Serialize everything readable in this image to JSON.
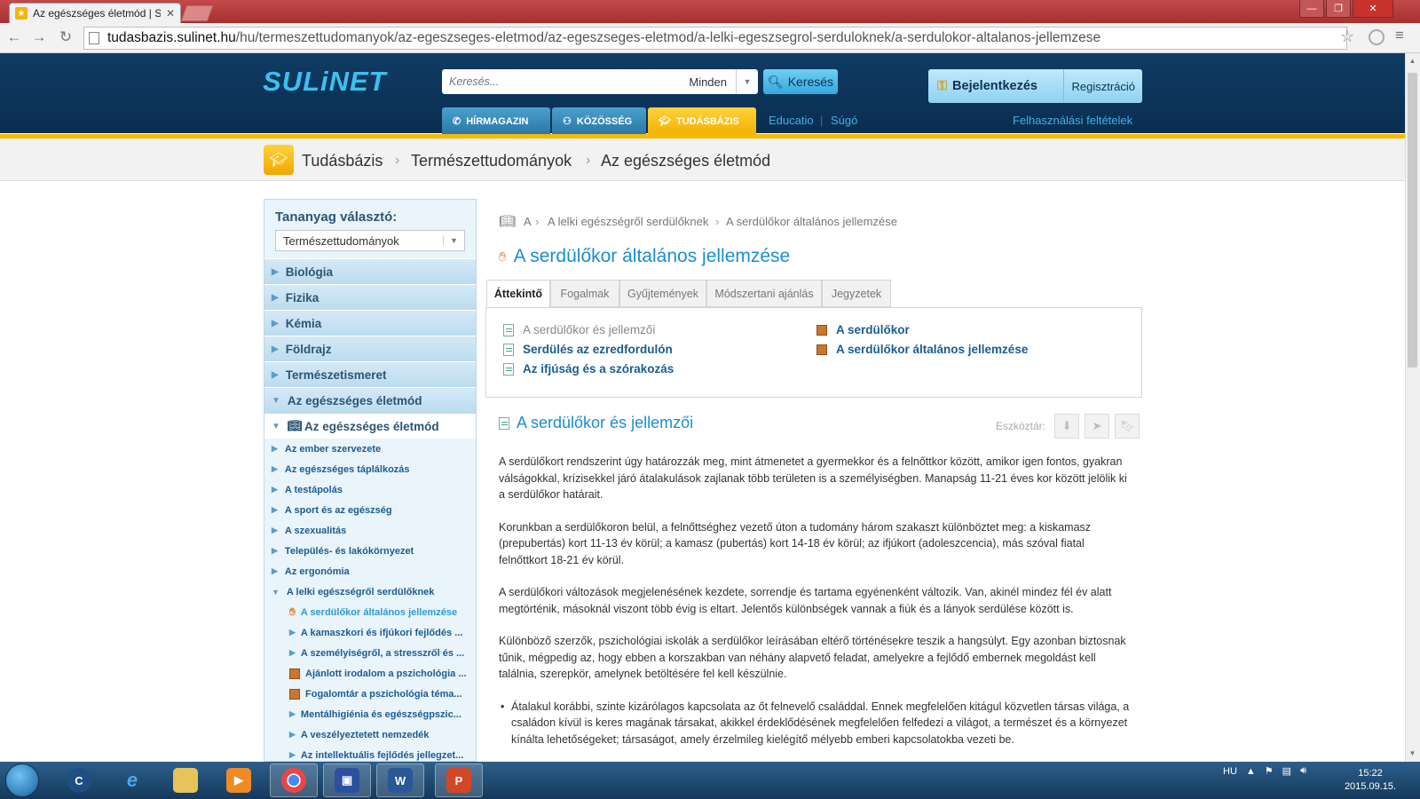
{
  "browser": {
    "tab_title": "Az egészséges életmód | S",
    "url_host": "tudasbazis.sulinet.hu",
    "url_path": "/hu/termeszettudomanyok/az-egeszseges-eletmod/az-egeszseges-eletmod/a-lelki-egeszsegrol-serduloknek/a-serdulokor-altalanos-jellemzese"
  },
  "header": {
    "logo": "SULiNET",
    "search_placeholder": "Keresés...",
    "search_scope": "Minden",
    "search_button": "Keresés",
    "login": "Bejelentkezés",
    "register": "Regisztráció",
    "tabs": [
      "HÍRMAGAZIN",
      "KÖZÖSSÉG",
      "TUDÁSBÁZIS"
    ],
    "links": [
      "Educatio",
      "Súgó"
    ],
    "terms": "Felhasználási feltételek"
  },
  "breadcrumb": [
    "Tudásbázis",
    "Természettudományok",
    "Az egészséges életmód"
  ],
  "sidebar": {
    "heading": "Tananyag választó:",
    "select_value": "Természettudományok",
    "categories": [
      "Biológia",
      "Fizika",
      "Kémia",
      "Földrajz",
      "Természetismeret",
      "Az egészséges életmód"
    ],
    "active": "Az egészséges életmód",
    "subs": [
      "Az ember szervezete",
      "Az egészséges táplálkozás",
      "A testápolás",
      "A sport és az egészség",
      "A szexualitás",
      "Település- és lakókörnyezet",
      "Az ergonómia",
      "A lelki egészségről serdülőknek"
    ],
    "subs2": [
      "A serdülőkor általános jellemzése",
      "A kamaszkori és ifjúkori fejlődés ...",
      "A személyiségről, a stresszről és ...",
      "Ajánlott irodalom a pszichológia ...",
      "Fogalomtár a pszichológia téma...",
      "Mentálhigiénia és egészségpszic...",
      "A veszélyeztetett nemzedék",
      "Az intellektuális fejlődés jellegzet..."
    ]
  },
  "main": {
    "crumb": [
      "A",
      "A lelki egészségről serdülőknek",
      "A serdülőkor általános jellemzése"
    ],
    "title": "A serdülőkor általános jellemzése",
    "tabs": [
      "Áttekintő",
      "Fogalmak",
      "Gyűjtemények",
      "Módszertani ajánlás",
      "Jegyzetek"
    ],
    "links_left": [
      "A serdülőkor és jellemzői",
      "Serdülés az ezredfordulón",
      "Az ifjúság és a szórakozás"
    ],
    "links_right": [
      "A serdülőkor",
      "A serdülőkor általános jellemzése"
    ],
    "section_title": "A serdülőkor és jellemzői",
    "toolbar_label": "Eszköztár:",
    "paragraphs": [
      "A serdülőkort rendszerint úgy határozzák meg, mint átmenetet a gyermekkor és a felnőttkor között, amikor igen fontos, gyakran válságokkal, krízisekkel járó átalakulások zajlanak több területen is a személyiségben. Manapság 11-21 éves kor között jelölik ki a serdülőkor határait.",
      "Korunkban a serdülőkoron belül, a felnőttséghez vezető úton a tudomány három szakaszt különböztet meg: a kiskamasz (prepubertás) kort 11-13 év körül; a kamasz (pubertás) kort 14-18 év körül; az ifjúkort (adoleszcencia), más szóval fiatal felnőttkort 18-21 év körül.",
      "A serdülőkori változások megjelenésének kezdete, sorrendje és tartama egyénenként változik. Van, akinél mindez fél év alatt megtörténik, másoknál viszont több évig is eltart. Jelentős különbségek vannak a fiúk és a lányok serdülése között is.",
      "Különböző szerzők, pszichológiai iskolák a serdülőkor leírásában eltérő történésekre teszik a hangsúlyt. Egy azonban biztosnak tűnik, mégpedig az, hogy ebben a korszakban van néhány alapvető feladat, amelyekre a fejlődő embernek megoldást kell találnia, szerepkör, amelynek betöltésére fel kell készülnie."
    ],
    "bullet": "Átalakul korábbi, szinte kizárólagos kapcsolata az őt felnevelő családdal. Ennek megfelelően kitágul közvetlen társas világa, a családon kívül is keres magának társakat, akikkel érdeklődésének megfelelően felfedezi a világot, a természet és a környezet kínálta lehetőségeket; társaságot, amely érzelmileg kielégítő mélyebb emberi kapcsolatokba vezeti be."
  },
  "taskbar": {
    "lang": "HU",
    "time": "15:22",
    "date": "2015.09.15.",
    "apps": [
      "ie",
      "explorer",
      "media",
      "chrome",
      "save",
      "word",
      "powerpoint"
    ]
  }
}
